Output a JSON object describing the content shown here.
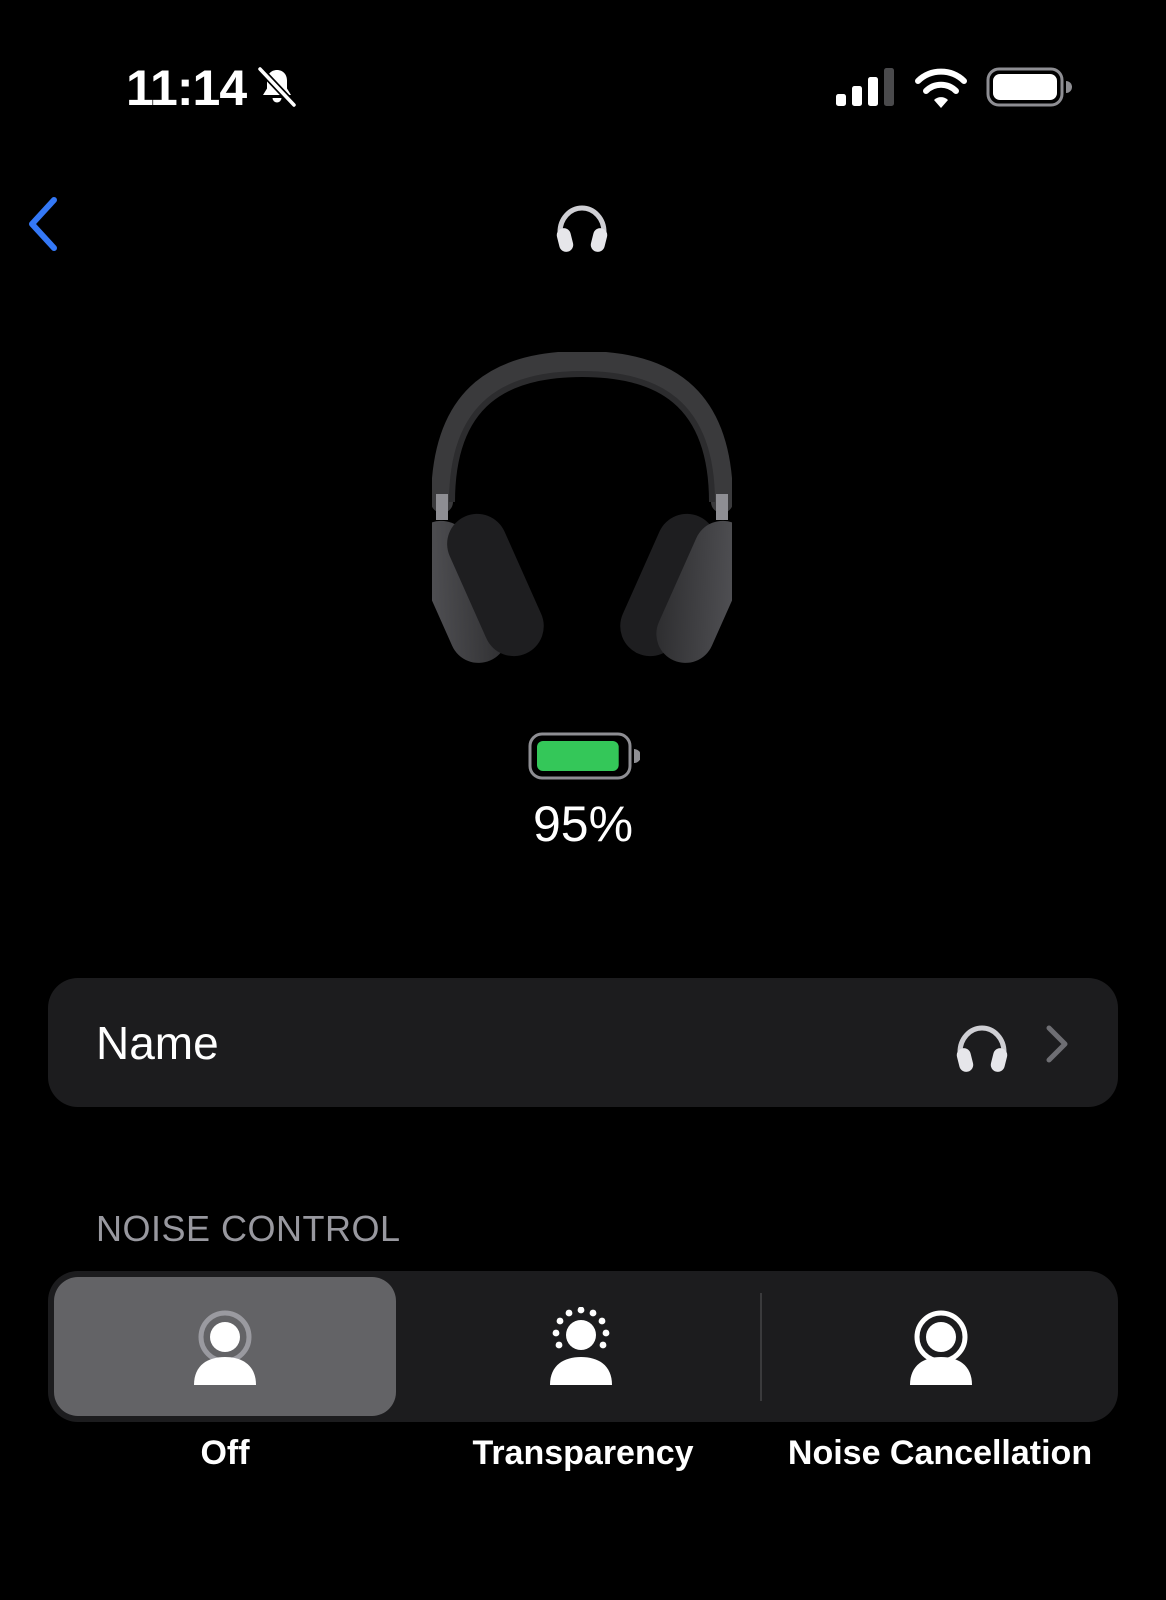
{
  "status_bar": {
    "time": "11:14",
    "icons": [
      "bell-slash-icon",
      "cellular-signal-icon",
      "wifi-icon",
      "battery-icon"
    ]
  },
  "nav": {
    "back_icon": "chevron-left-icon",
    "title_icon": "headphones-icon",
    "accent_color": "#3478f6"
  },
  "device": {
    "image": "airpods-max-headphones",
    "battery_percent": 95,
    "battery_label": "95%",
    "battery_color": "#34c759"
  },
  "name_row": {
    "label": "Name",
    "value_icon": "headphones-icon",
    "chevron_icon": "chevron-right-icon"
  },
  "noise_control": {
    "section_title": "NOISE CONTROL",
    "selected": "Off",
    "options": [
      {
        "label": "Off",
        "icon": "person-off-icon"
      },
      {
        "label": "Transparency",
        "icon": "person-transparency-icon"
      },
      {
        "label": "Noise Cancellation",
        "icon": "person-noise-cancellation-icon"
      }
    ]
  }
}
